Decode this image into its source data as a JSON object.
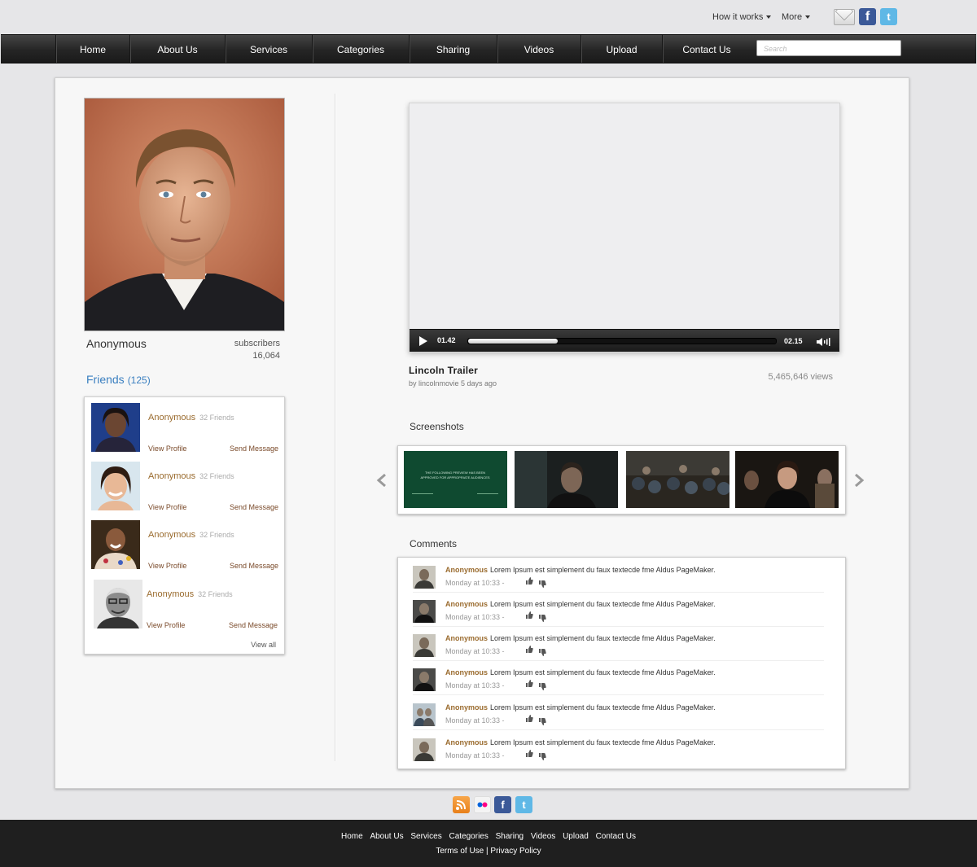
{
  "header": {
    "how_it_works": "How it works",
    "more": "More",
    "facebook_glyph": "f",
    "twitter_glyph": "t"
  },
  "nav": {
    "items": [
      "Home",
      "About Us",
      "Services",
      "Categories",
      "Sharing",
      "Videos",
      "Upload",
      "Contact Us"
    ],
    "search_placeholder": "Search"
  },
  "profile": {
    "name": "Anonymous",
    "subscribers_label": "subscribers",
    "subscribers_count": "16,064",
    "friends_label": "Friends",
    "friends_count": "(125)"
  },
  "friends": {
    "items": [
      {
        "name": "Anonymous",
        "count": "32 Friends",
        "view_profile": "View Profile",
        "send_message": "Send Message"
      },
      {
        "name": "Anonymous",
        "count": "32 Friends",
        "view_profile": "View Profile",
        "send_message": "Send Message"
      },
      {
        "name": "Anonymous",
        "count": "32 Friends",
        "view_profile": "View Profile",
        "send_message": "Send Message"
      },
      {
        "name": "Anonymous",
        "count": "32 Friends",
        "view_profile": "View Profile",
        "send_message": "Send Message"
      }
    ],
    "view_all": "View all"
  },
  "video": {
    "current_time": "01.42",
    "total_time": "02.15",
    "progress": 0.29,
    "title": "Lincoln Trailer",
    "byline": "by lincolnmovie 5 days ago",
    "views": "5,465,646 views"
  },
  "screenshots": {
    "title": "Screenshots",
    "first_frame_text": "THE FOLLOWING PREVIEW HAS BEEN APPROVED FOR APPROPRIATE AUDIENCES"
  },
  "comments": {
    "title": "Comments",
    "items": [
      {
        "author": "Anonymous",
        "text": "Lorem Ipsum est simplement du faux textecde fme Aldus PageMaker.",
        "time": "Monday at 10:33 -"
      },
      {
        "author": "Anonymous",
        "text": "Lorem Ipsum est simplement du faux textecde fme Aldus PageMaker.",
        "time": "Monday at 10:33 -"
      },
      {
        "author": "Anonymous",
        "text": "Lorem Ipsum est simplement du faux textecde fme Aldus PageMaker.",
        "time": "Monday at 10:33 -"
      },
      {
        "author": "Anonymous",
        "text": "Lorem Ipsum est simplement du faux textecde fme Aldus PageMaker.",
        "time": "Monday at 10:33 -"
      },
      {
        "author": "Anonymous",
        "text": "Lorem Ipsum est simplement du faux textecde fme Aldus PageMaker.",
        "time": "Monday at 10:33 -"
      },
      {
        "author": "Anonymous",
        "text": "Lorem Ipsum est simplement du faux textecde fme Aldus PageMaker.",
        "time": "Monday at 10:33 -"
      }
    ]
  },
  "footer": {
    "links": [
      "Home",
      "About Us",
      "Services",
      "Categories",
      "Sharing",
      "Videos",
      "Upload",
      "Contact Us"
    ],
    "terms": "Terms of Use",
    "separator": "|",
    "privacy": "Privacy Policy"
  },
  "colors": {
    "accent_link": "#3a7fc0",
    "author_brown": "#9a6b2e",
    "nav_dark": "#252525",
    "rss_orange": "#f08c1a",
    "facebook_blue": "#3b5998",
    "twitter_blue": "#5fb8e6"
  }
}
